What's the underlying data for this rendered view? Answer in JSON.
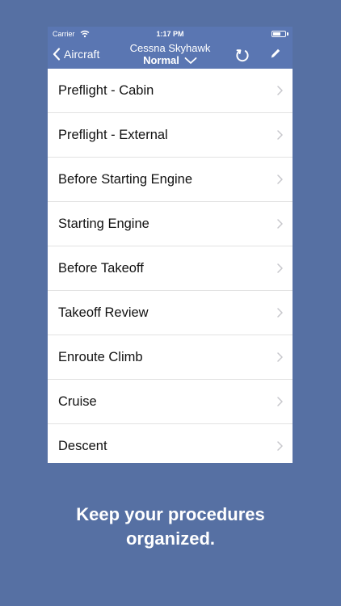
{
  "status_bar": {
    "carrier": "Carrier",
    "time": "1:17 PM"
  },
  "nav": {
    "back_label": "Aircraft",
    "title": "Cessna Skyhawk",
    "subtitle": "Normal"
  },
  "checklists": [
    {
      "label": "Preflight - Cabin"
    },
    {
      "label": "Preflight - External"
    },
    {
      "label": "Before Starting Engine"
    },
    {
      "label": "Starting Engine"
    },
    {
      "label": "Before Takeoff"
    },
    {
      "label": "Takeoff Review"
    },
    {
      "label": "Enroute Climb"
    },
    {
      "label": "Cruise"
    },
    {
      "label": "Descent"
    }
  ],
  "caption": {
    "line1": "Keep your procedures",
    "line2": "organized."
  },
  "colors": {
    "background": "#5670a3",
    "nav_bar": "#5a76b2",
    "chevron": "#c7c7cc"
  }
}
